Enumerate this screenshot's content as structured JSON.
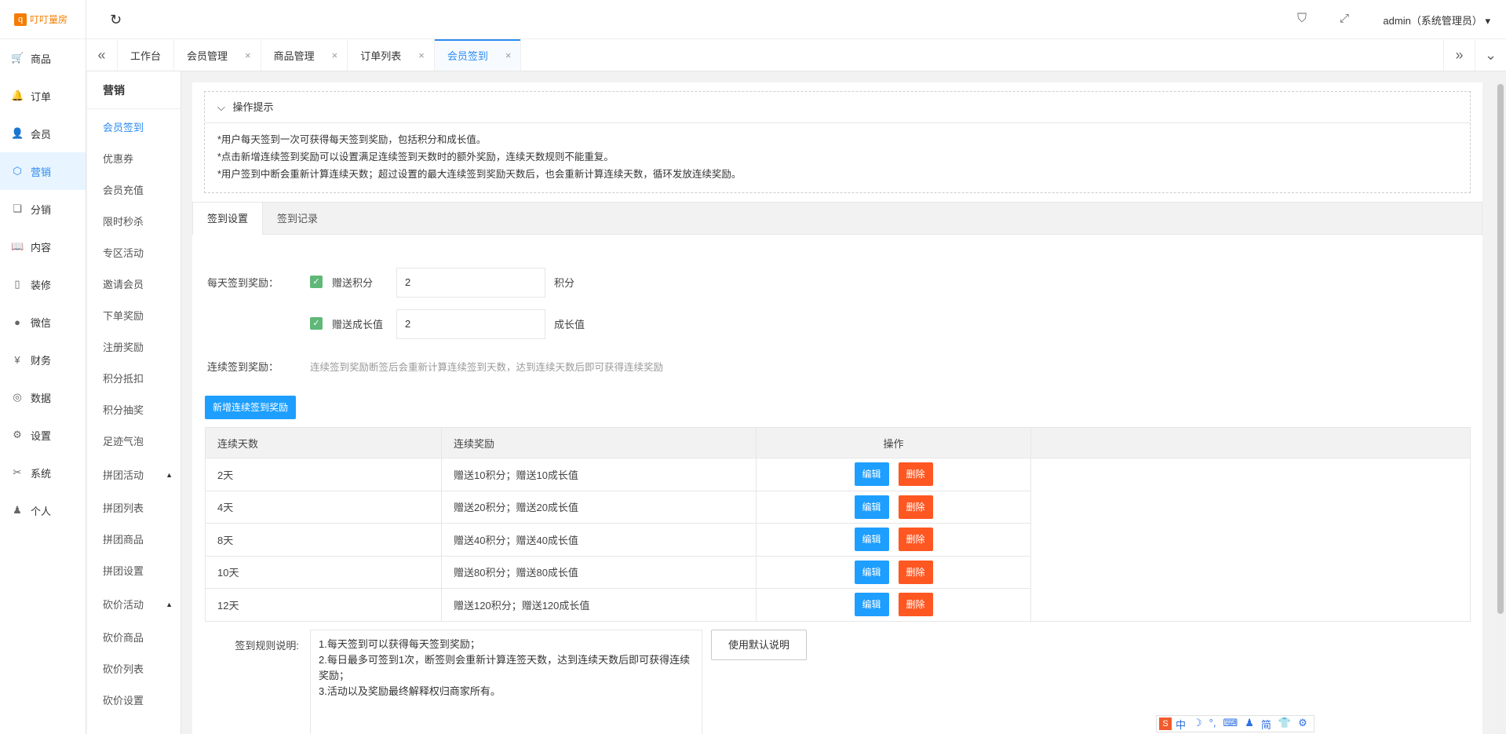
{
  "brand": {
    "logo_mark": "q",
    "name": "叮叮量房"
  },
  "leftnav": [
    {
      "label": "商品",
      "icon": "cart-icon",
      "glyph": "🛒"
    },
    {
      "label": "订单",
      "icon": "bell-icon",
      "glyph": "🔔"
    },
    {
      "label": "会员",
      "icon": "user-icon",
      "glyph": "👤"
    },
    {
      "label": "营销",
      "icon": "cube-icon",
      "glyph": "⬡",
      "active": true
    },
    {
      "label": "分销",
      "icon": "layers-icon",
      "glyph": "❏"
    },
    {
      "label": "内容",
      "icon": "book-icon",
      "glyph": "📖"
    },
    {
      "label": "装修",
      "icon": "phone-icon",
      "glyph": "▯"
    },
    {
      "label": "微信",
      "icon": "wechat-icon",
      "glyph": "●"
    },
    {
      "label": "财务",
      "icon": "yen-icon",
      "glyph": "¥"
    },
    {
      "label": "数据",
      "icon": "globe-icon",
      "glyph": "◎"
    },
    {
      "label": "设置",
      "icon": "gear-icon",
      "glyph": "⚙"
    },
    {
      "label": "系统",
      "icon": "tools-icon",
      "glyph": "✂"
    },
    {
      "label": "个人",
      "icon": "person-icon",
      "glyph": "♟"
    }
  ],
  "header": {
    "user": "admin（系统管理员）",
    "refresh_glyph": "↻",
    "tag_glyph": "⛉",
    "fullscreen_glyph": "⤢",
    "caret": "▾"
  },
  "tabs": [
    {
      "label": "工作台",
      "closable": false
    },
    {
      "label": "会员管理",
      "closable": true
    },
    {
      "label": "商品管理",
      "closable": true
    },
    {
      "label": "订单列表",
      "closable": true
    },
    {
      "label": "会员签到",
      "closable": true,
      "active": true
    }
  ],
  "tab_close_glyph": "×",
  "subnav": {
    "title": "营销",
    "items": [
      {
        "label": "会员签到",
        "active": true
      },
      {
        "label": "优惠券"
      },
      {
        "label": "会员充值"
      },
      {
        "label": "限时秒杀"
      },
      {
        "label": "专区活动"
      },
      {
        "label": "邀请会员"
      },
      {
        "label": "下单奖励"
      },
      {
        "label": "注册奖励"
      },
      {
        "label": "积分抵扣"
      },
      {
        "label": "积分抽奖"
      },
      {
        "label": "足迹气泡"
      }
    ],
    "group1": {
      "label": "拼团活动",
      "items": [
        "拼团列表",
        "拼团商品",
        "拼团设置"
      ]
    },
    "group2": {
      "label": "砍价活动",
      "items": [
        "砍价商品",
        "砍价列表",
        "砍价设置"
      ]
    }
  },
  "tips": {
    "title": "操作提示",
    "lines": [
      "*用户每天签到一次可获得每天签到奖励，包括积分和成长值。",
      "*点击新增连续签到奖励可以设置满足连续签到天数时的额外奖励，连续天数规则不能重复。",
      "*用户签到中断会重新计算连续天数；超过设置的最大连续签到奖励天数后，也会重新计算连续天数，循环发放连续奖励。"
    ]
  },
  "content_tabs": [
    "签到设置",
    "签到记录"
  ],
  "form": {
    "daily_label": "每天签到奖励：",
    "points_check": "赠送积分",
    "points_value": "2",
    "points_unit": "积分",
    "growth_check": "赠送成长值",
    "growth_value": "2",
    "growth_unit": "成长值",
    "streak_label": "连续签到奖励：",
    "streak_hint": "连续签到奖励断签后会重新计算连续签到天数，达到连续天数后即可获得连续奖励",
    "add_button": "新增连续签到奖励"
  },
  "table": {
    "headers": [
      "连续天数",
      "连续奖励",
      "操作"
    ],
    "edit_label": "编辑",
    "delete_label": "删除",
    "rows": [
      {
        "days": "2天",
        "reward": "赠送10积分；赠送10成长值"
      },
      {
        "days": "4天",
        "reward": "赠送20积分；赠送20成长值"
      },
      {
        "days": "8天",
        "reward": "赠送40积分；赠送40成长值"
      },
      {
        "days": "10天",
        "reward": "赠送80积分；赠送80成长值"
      },
      {
        "days": "12天",
        "reward": "赠送120积分；赠送120成长值"
      }
    ]
  },
  "rules": {
    "label": "签到规则说明:",
    "text": "1.每天签到可以获得每天签到奖励；\n2.每日最多可签到1次，断签则会重新计算连签天数，达到连续天数后即可获得连续奖励；\n3.活动以及奖励最终解释权归商家所有。",
    "default_button": "使用默认说明"
  },
  "ime": {
    "logo": "S",
    "items": [
      "中",
      "☽",
      "°,",
      "⌨",
      "♟",
      "简",
      "👕",
      "⚙"
    ]
  }
}
